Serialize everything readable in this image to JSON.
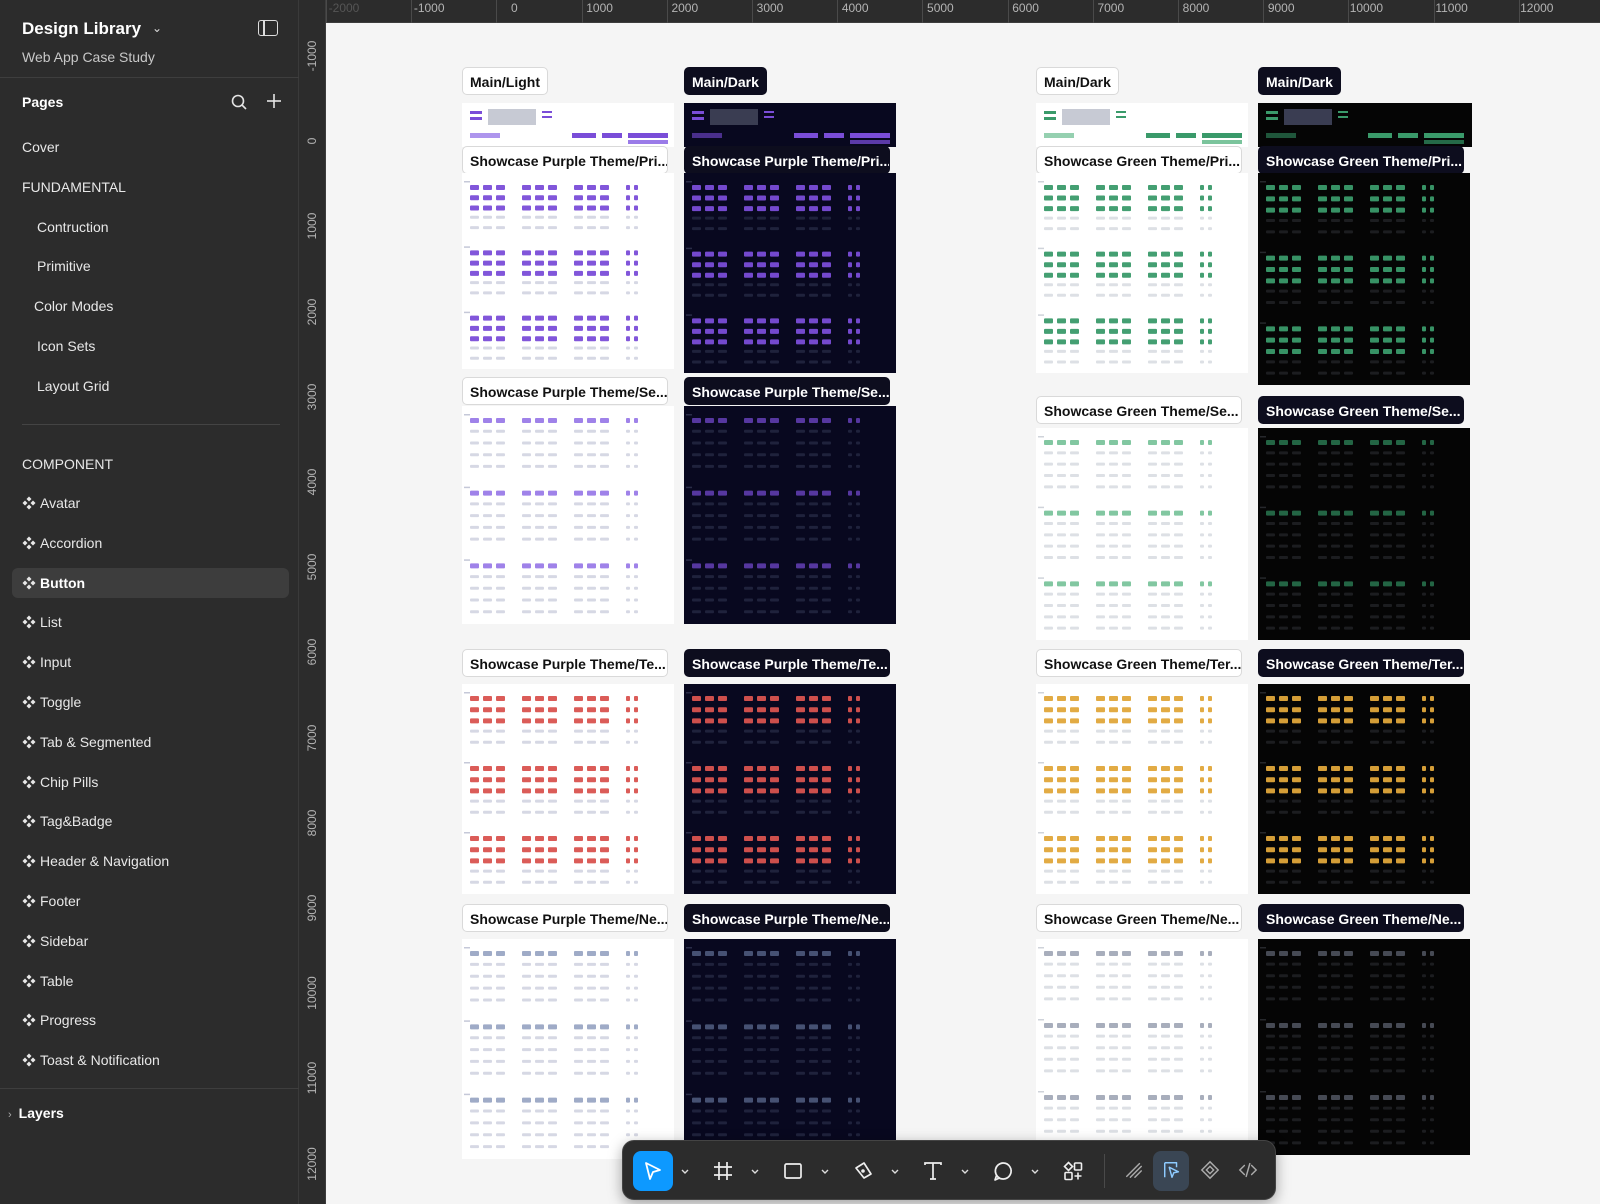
{
  "sidebar": {
    "title": "Design Library",
    "subtitle": "Web App Case Study",
    "pages_header": "Pages",
    "pages": [
      {
        "label": "Cover",
        "type": "page"
      },
      {
        "label": "FUNDAMENTAL",
        "type": "section"
      },
      {
        "label": "Contruction",
        "type": "sub"
      },
      {
        "label": "Primitive",
        "type": "sub"
      },
      {
        "label": "Color Modes",
        "type": "sub"
      },
      {
        "label": "Icon Sets",
        "type": "sub"
      },
      {
        "label": "Layout Grid",
        "type": "sub"
      }
    ],
    "component_header": "COMPONENT",
    "components": [
      {
        "label": "Avatar",
        "active": false
      },
      {
        "label": "Accordion",
        "active": false
      },
      {
        "label": "Button",
        "active": true
      },
      {
        "label": "List",
        "active": false
      },
      {
        "label": "Input",
        "active": false
      },
      {
        "label": "Toggle",
        "active": false
      },
      {
        "label": "Tab & Segmented",
        "active": false
      },
      {
        "label": "Chip Pills",
        "active": false
      },
      {
        "label": "Tag&Badge",
        "active": false
      },
      {
        "label": "Header & Navigation",
        "active": false
      },
      {
        "label": "Footer",
        "active": false
      },
      {
        "label": "Sidebar",
        "active": false
      },
      {
        "label": "Table",
        "active": false
      },
      {
        "label": "Progress",
        "active": false
      },
      {
        "label": "Toast & Notification",
        "active": false
      }
    ],
    "layers_label": "Layers"
  },
  "rulers": {
    "top": [
      "-2000",
      "-1000",
      "0",
      "1000",
      "2000",
      "3000",
      "4000",
      "5000",
      "6000",
      "7000",
      "8000",
      "9000",
      "10000",
      "11000",
      "12000"
    ],
    "left": [
      "-1000",
      "0",
      "1000",
      "2000",
      "3000",
      "4000",
      "5000",
      "6000",
      "7000",
      "8000",
      "9000",
      "10000",
      "11000",
      "12000"
    ]
  },
  "canvas": {
    "columns": [
      {
        "theme": "purple-light",
        "header": "Main/Light",
        "frames": [
          "Showcase Purple Theme/Pri...",
          "Showcase Purple Theme/Se...",
          "Showcase Purple Theme/Te...",
          "Showcase Purple Theme/Ne..."
        ]
      },
      {
        "theme": "purple-dark",
        "header": "Main/Dark",
        "frames": [
          "Showcase Purple Theme/Pri...",
          "Showcase Purple Theme/Se...",
          "Showcase Purple Theme/Te...",
          "Showcase Purple Theme/Ne..."
        ]
      },
      {
        "theme": "green-light",
        "header": "Main/Dark",
        "frames": [
          "Showcase Green Theme/Pri...",
          "Showcase Green Theme/Se...",
          "Showcase Green Theme/Ter...",
          "Showcase Green Theme/Ne..."
        ]
      },
      {
        "theme": "green-dark",
        "header": "Main/Dark",
        "frames": [
          "Showcase Green Theme/Pri...",
          "Showcase Green Theme/Se...",
          "Showcase Green Theme/Ter...",
          "Showcase Green Theme/Ne..."
        ]
      }
    ]
  },
  "toolbar": {
    "tools": [
      "move-tool",
      "frame-tool",
      "rectangle-tool",
      "pen-tool",
      "text-tool",
      "comment-tool",
      "actions-tool"
    ],
    "modes": [
      "draw-mode",
      "design-mode",
      "prototype-mode",
      "dev-mode"
    ]
  },
  "colors": {
    "accent": "#0d99ff",
    "purple": "#7a4dd8",
    "red": "#d9534f",
    "green": "#3a9a6a",
    "gold": "#e0a63a",
    "dark_navy": "#08081f",
    "black": "#050505"
  }
}
